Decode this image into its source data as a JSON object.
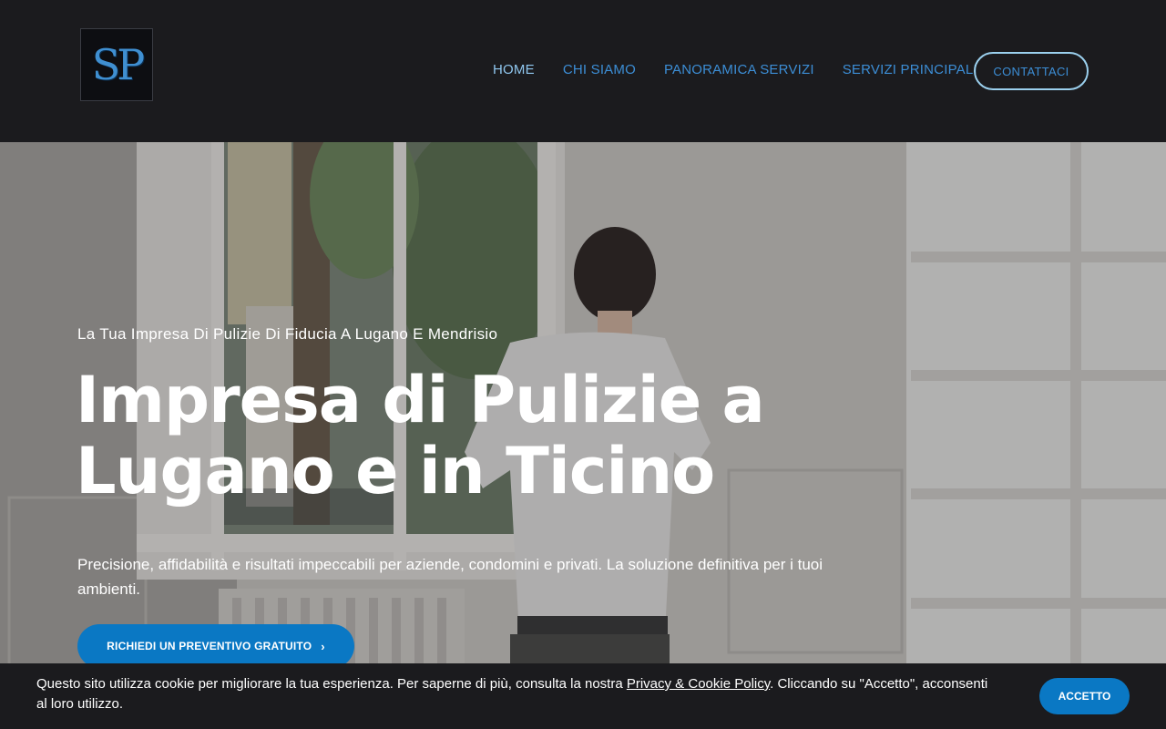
{
  "header": {
    "logo_text": "SP",
    "nav": [
      {
        "label": "HOME",
        "active": true
      },
      {
        "label": "CHI SIAMO",
        "active": false
      },
      {
        "label": "PANORAMICA SERVIZI",
        "active": false
      },
      {
        "label": "SERVIZI PRINCIPALI",
        "active": false
      }
    ],
    "contact_label": "CONTATTACI"
  },
  "hero": {
    "kicker": "La Tua Impresa Di Pulizie Di Fiducia A Lugano E Mendrisio",
    "title": "Impresa di Pulizie a Lugano e in Ticino",
    "description": "Precisione, affidabilità e risultati impeccabili per aziende, condomini e privati. La soluzione definitiva per i tuoi ambienti.",
    "cta_label": "RICHIEDI UN PREVENTIVO GRATUITO",
    "cta_icon": "chevron-right-icon",
    "image_label": "photo of cleaner in bright room with window and white shelves"
  },
  "cookie": {
    "text_before": "Questo sito utilizza cookie per migliorare la tua esperienza. Per saperne di più, consulta la nostra ",
    "link_label": "Privacy & Cookie Policy",
    "text_after": ". Cliccando su \"Accetto\", acconsenti al loro utilizzo.",
    "accept_label": "ACCETTO"
  },
  "colors": {
    "header_bg": "#1b1b1e",
    "nav_link": "#3c8ed6",
    "nav_active": "#8fc6ee",
    "accent_button": "#0a78c4"
  }
}
